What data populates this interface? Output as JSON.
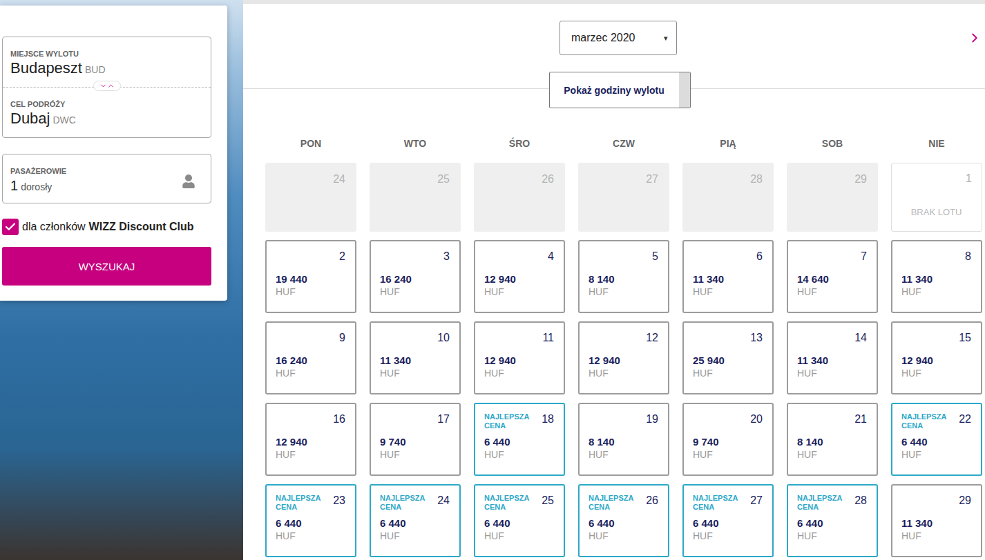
{
  "search": {
    "origin": {
      "label": "MIEJSCE WYLOTU",
      "city": "Budapeszt",
      "code": "BUD"
    },
    "destination": {
      "label": "CEL PODRÓŻY",
      "city": "Dubaj",
      "code": "DWC"
    },
    "passengers": {
      "label": "PASAŻEROWIE",
      "count": "1",
      "unit": "dorosły"
    },
    "discount_club": {
      "prefix": "dla członków",
      "bold": "WIZZ Discount Club",
      "checked": true
    },
    "search_button": "WYSZUKAJ"
  },
  "calendar": {
    "month": "marzec 2020",
    "month_arrow": "▾",
    "departure_times_button": "Pokaż godziny wylotu",
    "weekdays": [
      "PON",
      "WTO",
      "ŚRO",
      "CZW",
      "PIĄ",
      "SOB",
      "NIE"
    ],
    "days": [
      {
        "day": "24",
        "kind": "past"
      },
      {
        "day": "25",
        "kind": "past"
      },
      {
        "day": "26",
        "kind": "past"
      },
      {
        "day": "27",
        "kind": "past"
      },
      {
        "day": "28",
        "kind": "past"
      },
      {
        "day": "29",
        "kind": "past"
      },
      {
        "day": "1",
        "kind": "no-flight",
        "note": "BRAK LOTU"
      },
      {
        "day": "2",
        "kind": "flight",
        "price": "19 440",
        "currency": "HUF",
        "best": false
      },
      {
        "day": "3",
        "kind": "flight",
        "price": "16 240",
        "currency": "HUF",
        "best": false
      },
      {
        "day": "4",
        "kind": "flight",
        "price": "12 940",
        "currency": "HUF",
        "best": false
      },
      {
        "day": "5",
        "kind": "flight",
        "price": "8 140",
        "currency": "HUF",
        "best": false
      },
      {
        "day": "6",
        "kind": "flight",
        "price": "11 340",
        "currency": "HUF",
        "best": false
      },
      {
        "day": "7",
        "kind": "flight",
        "price": "14 640",
        "currency": "HUF",
        "best": false
      },
      {
        "day": "8",
        "kind": "flight",
        "price": "11 340",
        "currency": "HUF",
        "best": false
      },
      {
        "day": "9",
        "kind": "flight",
        "price": "16 240",
        "currency": "HUF",
        "best": false
      },
      {
        "day": "10",
        "kind": "flight",
        "price": "11 340",
        "currency": "HUF",
        "best": false
      },
      {
        "day": "11",
        "kind": "flight",
        "price": "12 940",
        "currency": "HUF",
        "best": false
      },
      {
        "day": "12",
        "kind": "flight",
        "price": "12 940",
        "currency": "HUF",
        "best": false
      },
      {
        "day": "13",
        "kind": "flight",
        "price": "25 940",
        "currency": "HUF",
        "best": false
      },
      {
        "day": "14",
        "kind": "flight",
        "price": "11 340",
        "currency": "HUF",
        "best": false
      },
      {
        "day": "15",
        "kind": "flight",
        "price": "12 940",
        "currency": "HUF",
        "best": false
      },
      {
        "day": "16",
        "kind": "flight",
        "price": "12 940",
        "currency": "HUF",
        "best": false
      },
      {
        "day": "17",
        "kind": "flight",
        "price": "9 740",
        "currency": "HUF",
        "best": false
      },
      {
        "day": "18",
        "kind": "flight",
        "price": "6 440",
        "currency": "HUF",
        "best": true,
        "badge": "NAJLEPSZA CENA"
      },
      {
        "day": "19",
        "kind": "flight",
        "price": "8 140",
        "currency": "HUF",
        "best": false
      },
      {
        "day": "20",
        "kind": "flight",
        "price": "9 740",
        "currency": "HUF",
        "best": false
      },
      {
        "day": "21",
        "kind": "flight",
        "price": "8 140",
        "currency": "HUF",
        "best": false
      },
      {
        "day": "22",
        "kind": "flight",
        "price": "6 440",
        "currency": "HUF",
        "best": true,
        "badge": "NAJLEPSZA CENA"
      },
      {
        "day": "23",
        "kind": "flight",
        "price": "6 440",
        "currency": "HUF",
        "best": true,
        "badge": "NAJLEPSZA CENA"
      },
      {
        "day": "24",
        "kind": "flight",
        "price": "6 440",
        "currency": "HUF",
        "best": true,
        "badge": "NAJLEPSZA CENA"
      },
      {
        "day": "25",
        "kind": "flight",
        "price": "6 440",
        "currency": "HUF",
        "best": true,
        "badge": "NAJLEPSZA CENA"
      },
      {
        "day": "26",
        "kind": "flight",
        "price": "6 440",
        "currency": "HUF",
        "best": true,
        "badge": "NAJLEPSZA CENA"
      },
      {
        "day": "27",
        "kind": "flight",
        "price": "6 440",
        "currency": "HUF",
        "best": true,
        "badge": "NAJLEPSZA CENA"
      },
      {
        "day": "28",
        "kind": "flight",
        "price": "6 440",
        "currency": "HUF",
        "best": true,
        "badge": "NAJLEPSZA CENA"
      },
      {
        "day": "29",
        "kind": "flight",
        "price": "11 340",
        "currency": "HUF",
        "best": false
      }
    ]
  }
}
